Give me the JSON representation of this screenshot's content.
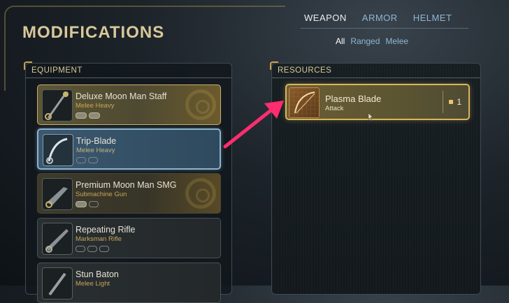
{
  "screen_title": "MODIFICATIONS",
  "top_tabs": [
    {
      "label": "WEAPON",
      "active": true
    },
    {
      "label": "ARMOR",
      "active": false
    },
    {
      "label": "HELMET",
      "active": false
    }
  ],
  "filters": [
    {
      "label": "All",
      "active": true
    },
    {
      "label": "Ranged",
      "active": false
    },
    {
      "label": "Melee",
      "active": false
    }
  ],
  "equipment": {
    "header": "EQUIPMENT",
    "items": [
      {
        "name": "Deluxe Moon Man Staff",
        "type": "Melee Heavy",
        "style": "gold",
        "slots_filled": 2,
        "slots_total": 2
      },
      {
        "name": "Trip-Blade",
        "type": "Melee Heavy",
        "style": "selected",
        "slots_filled": 0,
        "slots_total": 2
      },
      {
        "name": "Premium Moon Man SMG",
        "type": "Submachine Gun",
        "style": "gold2",
        "slots_filled": 1,
        "slots_total": 2
      },
      {
        "name": "Repeating Rifle",
        "type": "Marksman Rifle",
        "style": "plain",
        "slots_filled": 0,
        "slots_total": 3
      },
      {
        "name": "Stun Baton",
        "type": "Melee Light",
        "style": "plain",
        "slots_filled": 0,
        "slots_total": 0
      }
    ]
  },
  "resources": {
    "header": "RESOURCES",
    "items": [
      {
        "name": "Plasma Blade",
        "type": "Attack",
        "count": "1"
      }
    ]
  },
  "colors": {
    "accent_gold": "#d9b65a",
    "selected_blue": "#8db3cc",
    "arrow_pink": "#ff2d6f"
  }
}
